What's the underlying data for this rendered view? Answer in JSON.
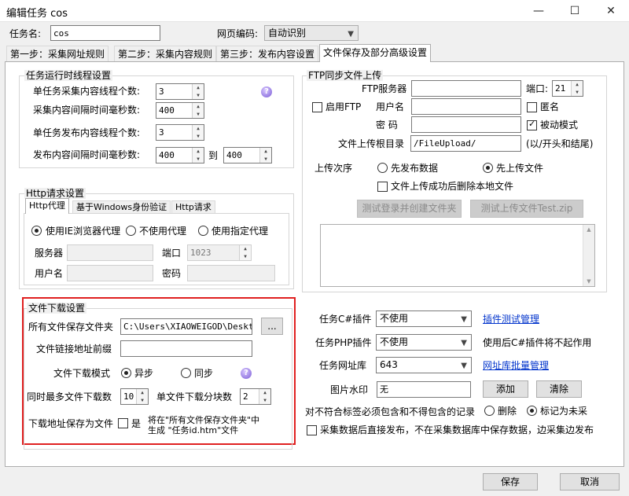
{
  "window": {
    "title": "编辑任务 cos",
    "minimize": "—",
    "maximize": "☐",
    "close": "✕"
  },
  "header": {
    "task_name_label": "任务名:",
    "task_name_value": "cos",
    "encoding_label": "网页编码:",
    "encoding_value": "自动识别"
  },
  "tabs": [
    {
      "label": "第一步：采集网址规则"
    },
    {
      "label": "第二步：采集内容规则"
    },
    {
      "label": "第三步：发布内容设置"
    },
    {
      "label": "文件保存及部分高级设置"
    }
  ],
  "thread_settings": {
    "title": "任务运行时线程设置",
    "row1_label": "单任务采集内容线程个数:",
    "row1_value": "3",
    "row2_label": "采集内容间隔时间毫秒数:",
    "row2_value": "400",
    "row3_label": "单任务发布内容线程个数:",
    "row3_value": "3",
    "row4_label": "发布内容间隔时间毫秒数:",
    "row4_from": "400",
    "row4_to_label": "到",
    "row4_to": "400"
  },
  "http": {
    "title": "Http请求设置",
    "subtabs": [
      "Http代理",
      "基于Windows身份验证",
      "Http请求"
    ],
    "radio_ie": "使用IE浏览器代理",
    "radio_none": "不使用代理",
    "radio_custom": "使用指定代理",
    "server_label": "服务器",
    "port_label": "端口",
    "port_value": "1023",
    "user_label": "用户名",
    "password_label": "密码"
  },
  "download": {
    "title": "文件下载设置",
    "save_folder_label": "所有文件保存文件夹",
    "save_folder_value": "C:\\Users\\XIAOWEIGOD\\Desktop",
    "browse_label": "...",
    "prefix_label": "文件链接地址前缀",
    "mode_label": "文件下载模式",
    "mode_async": "异步",
    "mode_sync": "同步",
    "max_label": "同时最多文件下载数",
    "max_value": "10",
    "chunks_label": "单文件下载分块数",
    "chunks_value": "2",
    "save_as_label": "下载地址保存为文件",
    "yes_label": "是",
    "note_line1": "将在\"所有文件保存文件夹\"中",
    "note_line2": "生成 \"任务id.htm\"文件"
  },
  "ftp": {
    "title": "FTP同步文件上传",
    "server_label": "FTP服务器",
    "port_label": "端口:",
    "port_value": "21",
    "enable_label": "启用FTP",
    "user_label": "用户名",
    "anon_label": "匿名",
    "password_label": "密  码",
    "passive_label": "被动模式",
    "root_label": "文件上传根目录",
    "root_value": "/FileUpload/",
    "root_hint": "(以/开头和结尾)",
    "order_label": "上传次序",
    "order_publish": "先发布数据",
    "order_upload": "先上传文件",
    "delete_label": "文件上传成功后删除本地文件",
    "test_login": "测试登录并创建文件夹",
    "test_upload": "测试上传文件Test.zip"
  },
  "plugins": {
    "csharp_label": "任务C#插件",
    "csharp_value": "不使用",
    "csharp_link": "插件测试管理",
    "php_label": "任务PHP插件",
    "php_value": "不使用",
    "php_note": "使用后C#插件将不起作用",
    "site_label": "任务网址库",
    "site_value": "643",
    "site_link": "网址库批量管理",
    "watermark_label": "图片水印",
    "watermark_value": "无",
    "add_label": "添加",
    "clear_label": "清除",
    "mismatch_label": "对不符合标签必须包含和不得包含的记录",
    "delete_label": "删除",
    "mark_label": "标记为未采",
    "direct_publish_label": "采集数据后直接发布，不在采集数据库中保存数据，边采集边发布"
  },
  "footer": {
    "save": "保存",
    "cancel": "取消"
  },
  "colors": {
    "highlight_border": "#e02020",
    "link": "#0033cc"
  }
}
